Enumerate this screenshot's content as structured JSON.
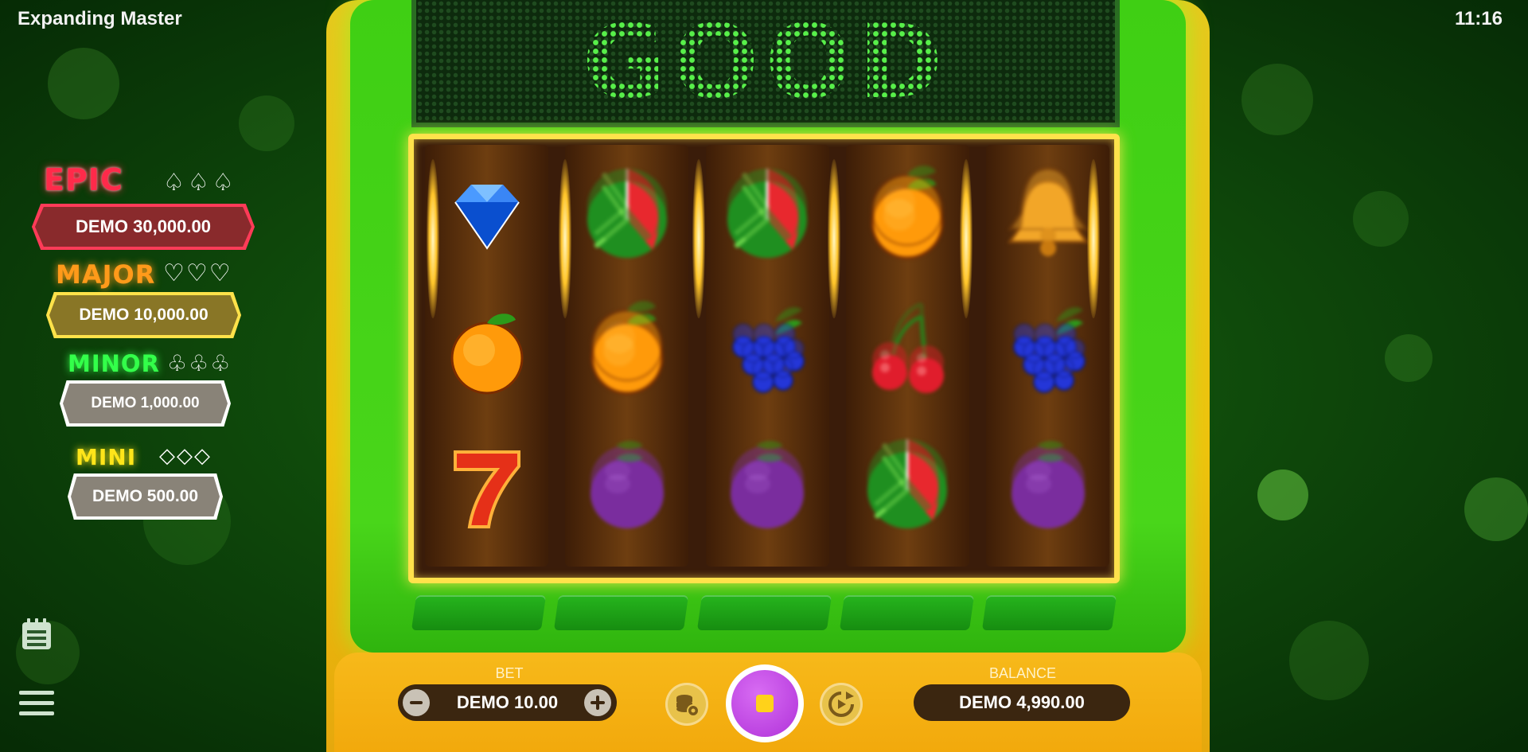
{
  "app": {
    "title": "Expanding Master",
    "time": "11:16"
  },
  "jackpots": [
    {
      "name": "EPIC",
      "suits": "♤♤♤",
      "amount": "DEMO 30,000.00",
      "color": "#ff2a4a"
    },
    {
      "name": "MAJOR",
      "suits": "♡♡♡",
      "amount": "DEMO 10,000.00",
      "color": "#ff9a1a"
    },
    {
      "name": "MINOR",
      "suits": "♧♧♧",
      "amount": "DEMO 1,000.00",
      "color": "#33ff4a"
    },
    {
      "name": "MINI",
      "suits": "◇◇◇",
      "amount": "DEMO 500.00",
      "color": "#ffe51a"
    }
  ],
  "marquee": {
    "text": "GOOD LUCK"
  },
  "reels": [
    [
      "diamond",
      "orange",
      "seven"
    ],
    [
      "watermelon",
      "orange",
      "plum"
    ],
    [
      "watermelon",
      "grapes",
      "plum"
    ],
    [
      "orange",
      "cherries",
      "watermelon"
    ],
    [
      "bell",
      "grapes",
      "plum"
    ]
  ],
  "controls": {
    "bet_label": "BET",
    "bet_value": "DEMO 10.00",
    "balance_label": "BALANCE",
    "balance_value": "DEMO 4,990.00"
  },
  "icons": {
    "paytable": "paytable-icon",
    "menu": "menu-icon",
    "bet_minus": "minus-icon",
    "bet_plus": "plus-icon",
    "coins": "coins-settings-icon",
    "spin": "stop-icon",
    "autoplay": "autoplay-icon"
  },
  "colors": {
    "background": "#0f4a0b",
    "cabinet_yellow": "#f0c20d",
    "cabinet_green": "#49d61a",
    "marquee_led": "#58f04a",
    "spin_button": "#c14be8",
    "stop_square": "#ffd21a"
  }
}
